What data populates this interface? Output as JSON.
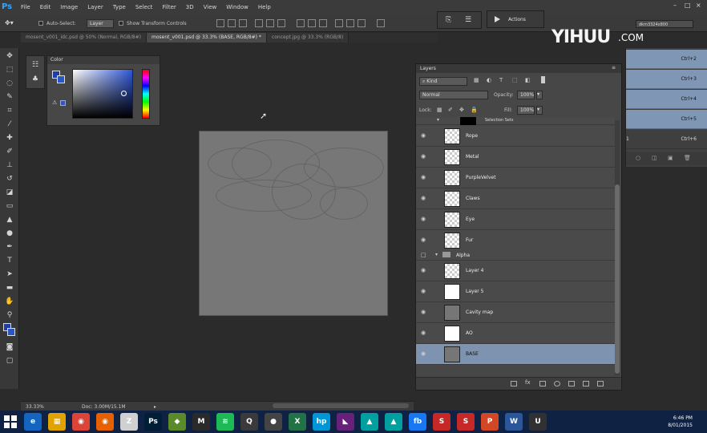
{
  "app": {
    "logo": "Ps"
  },
  "menu": [
    "File",
    "Edit",
    "Image",
    "Layer",
    "Type",
    "Select",
    "Filter",
    "3D",
    "View",
    "Window",
    "Help"
  ],
  "options_bar": {
    "auto_select_label": "Auto-Select:",
    "auto_select_value": "Layer",
    "transform_label": "Show Transform Controls"
  },
  "tabs": [
    "mosent_v001_idc.psd @ 50% (Normal, RGB/8#)",
    "mosent_v001.psd @ 33.3% (BASE, RGB/8#) *",
    "concept.jpg @ 33.3% (RGB/8)"
  ],
  "workspace": "dkm3324x800",
  "actions_panel": {
    "label": "Actions"
  },
  "color_panel": {
    "title": "Color"
  },
  "history": {
    "shortcuts": [
      "Ctrl+2",
      "Ctrl+3",
      "Ctrl+4",
      "Ctrl+5",
      "Ctrl+6"
    ],
    "extra_label": "1"
  },
  "layers_panel": {
    "title": "Layers",
    "filter_kind": "Kind",
    "blend_mode": "Normal",
    "opacity_label": "Opacity:",
    "opacity_value": "100%",
    "lock_label": "Lock:",
    "fill_label": "Fill:",
    "fill_value": "100%",
    "partial_layer": "Selection Sets",
    "layers": [
      {
        "name": "Rope",
        "thumb": "checker"
      },
      {
        "name": "Metal",
        "thumb": "checker"
      },
      {
        "name": "PurpleVelvet",
        "thumb": "checker"
      },
      {
        "name": "Claws",
        "thumb": "checker"
      },
      {
        "name": "Eye",
        "thumb": "checker"
      },
      {
        "name": "Fur",
        "thumb": "checker"
      }
    ],
    "group": "Alpha",
    "group_layers": [
      {
        "name": "Layer 4",
        "thumb": "checker"
      },
      {
        "name": "Layer 5",
        "thumb": "white"
      },
      {
        "name": "Cavity map",
        "thumb": "gray"
      },
      {
        "name": "AO",
        "thumb": "white"
      },
      {
        "name": "BASE",
        "thumb": "gray",
        "selected": true
      }
    ]
  },
  "status": {
    "zoom": "33.33%",
    "doc": "Doc: 3.00M/15.1M"
  },
  "watermark": {
    "brand": "YIHUU",
    "domain": ".COM"
  },
  "clock": {
    "time": "6:46 PM",
    "date": "8/01/2015"
  },
  "taskbar_icons": [
    "ie-icon",
    "explorer-icon",
    "chrome-icon",
    "firefox-icon",
    "zbrush-icon",
    "photoshop-icon",
    "substance-icon",
    "3dsmax-icon",
    "spotify-icon",
    "quicktime-icon",
    "obs-icon",
    "excel-icon",
    "hp-icon",
    "vs-icon",
    "app-icon",
    "app2-icon",
    "fb-icon",
    "app3-icon",
    "app4-icon",
    "powerpoint-icon",
    "word-icon",
    "unreal-icon"
  ],
  "colors": {
    "selected_layer": "#7e93b0",
    "taskbar": "#0f2244",
    "accent": "#31a8ff"
  }
}
